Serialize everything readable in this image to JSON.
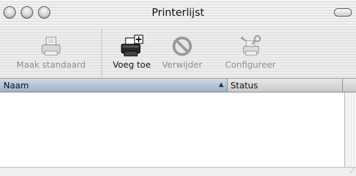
{
  "window": {
    "title": "Printerlijst"
  },
  "toolbar": {
    "make_default": "Maak standaard",
    "add": "Voeg toe",
    "remove": "Verwijder",
    "configure": "Configureer"
  },
  "list": {
    "columns": [
      "Naam",
      "Status"
    ],
    "sort_column": "Naam",
    "rows": []
  },
  "icons": {
    "make_default": "printer-icon",
    "add": "printer-add-icon",
    "remove": "prohibited-icon",
    "configure": "printer-tools-icon"
  }
}
